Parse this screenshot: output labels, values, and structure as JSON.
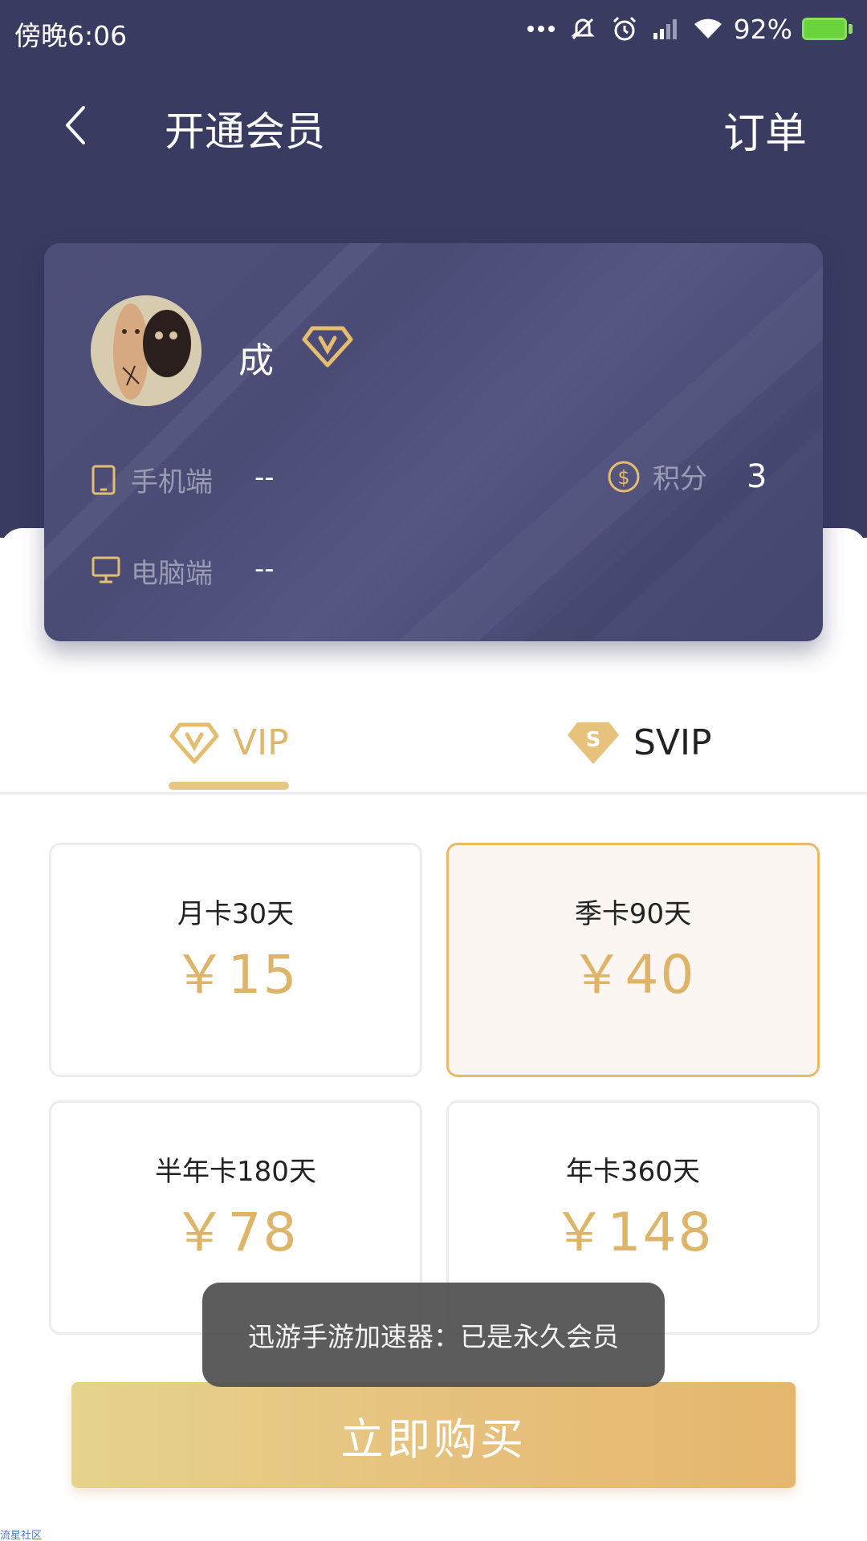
{
  "status_bar": {
    "time": "傍晚6:06",
    "battery": "92%"
  },
  "nav": {
    "title": "开通会员",
    "orders": "订单"
  },
  "profile": {
    "username": "成",
    "mobile_label": "手机端",
    "mobile_value": "--",
    "pc_label": "电脑端",
    "pc_value": "--",
    "points_label": "积分",
    "points_value": "3"
  },
  "tabs": [
    {
      "label": "VIP",
      "selected": true
    },
    {
      "label": "SVIP",
      "selected": false
    }
  ],
  "plans": [
    {
      "name": "月卡30天",
      "price": "￥15",
      "selected": false
    },
    {
      "name": "季卡90天",
      "price": "￥40",
      "selected": true
    },
    {
      "name": "半年卡180天",
      "price": "￥78",
      "selected": false
    },
    {
      "name": "年卡360天",
      "price": "￥148",
      "selected": false
    }
  ],
  "toast": "迅游手游加速器：已是永久会员",
  "buy_button": "立即购买",
  "watermark": "流星社区",
  "colors": {
    "header_bg": "#3a3b60",
    "gold": "#deb468",
    "selected_border": "#e9b969"
  }
}
